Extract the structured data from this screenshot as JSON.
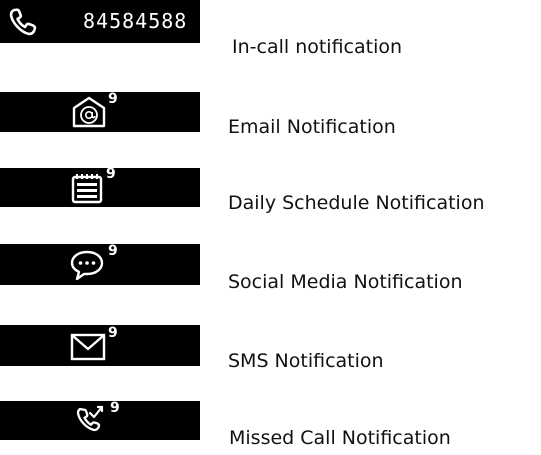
{
  "notifications": [
    {
      "icon": "phone-icon",
      "number": "84584588",
      "caption": "In-call notification"
    },
    {
      "icon": "email-at-icon",
      "badge": "9",
      "caption": "Email Notification"
    },
    {
      "icon": "calendar-icon",
      "badge": "9",
      "caption": "Daily Schedule Notification"
    },
    {
      "icon": "chat-bubble-icon",
      "badge": "9",
      "caption": "Social Media Notification"
    },
    {
      "icon": "envelope-icon",
      "badge": "9",
      "caption": "SMS Notification"
    },
    {
      "icon": "missed-call-icon",
      "badge": "9",
      "caption": "Missed Call Notification"
    }
  ],
  "colors": {
    "screen_background": "#000000",
    "screen_foreground": "#ffffff",
    "caption_text": "#111111"
  }
}
